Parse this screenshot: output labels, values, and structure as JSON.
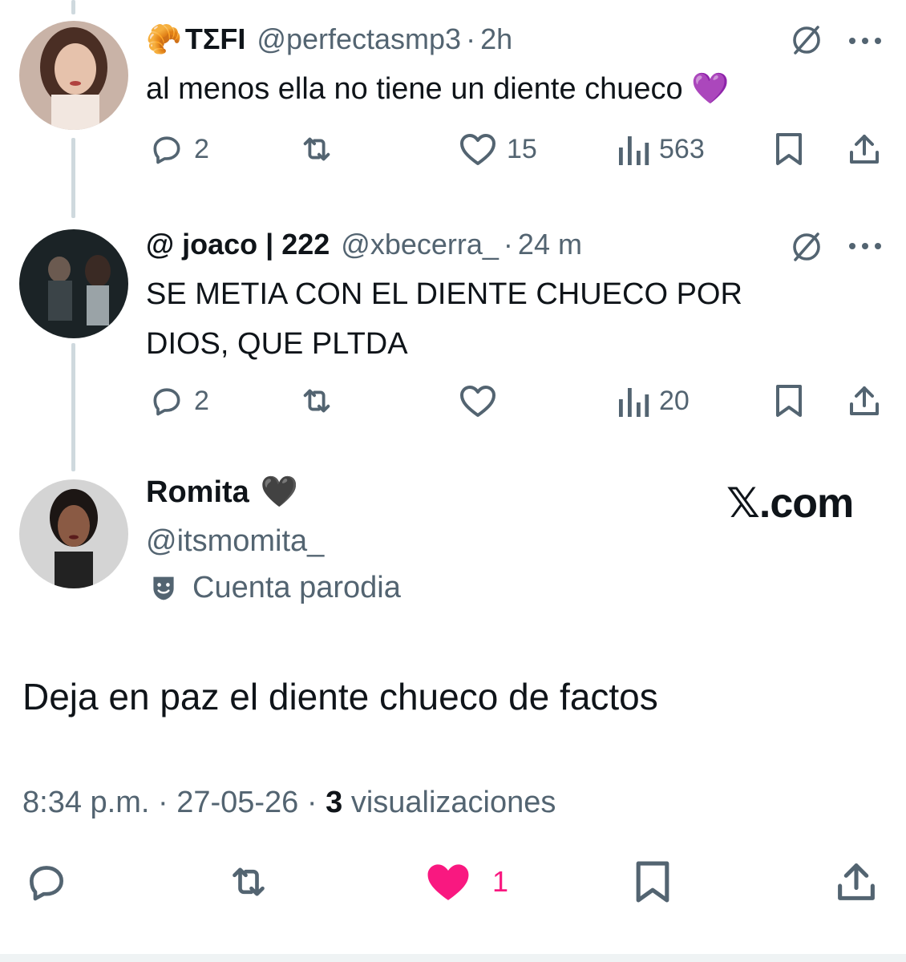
{
  "tweets": [
    {
      "emoji": "🥐",
      "display_name": "ΤΣFI",
      "handle": "@perfectasmp3",
      "separator": "·",
      "time": "2h",
      "text_lines": [
        "al menos ella no tiene un diente chueco 💜"
      ],
      "replies": "2",
      "retweets": "",
      "likes": "15",
      "views": "563"
    },
    {
      "display_name": "@ joaco | 222",
      "handle": "@xbecerra_",
      "separator": "·",
      "time": "24 m",
      "text_lines": [
        "SE METIA CON EL DIENTE CHUECO POR",
        "DIOS, QUE PLTDA"
      ],
      "replies": "2",
      "retweets": "",
      "likes": "",
      "views": "20"
    }
  ],
  "main_tweet": {
    "display_name": "Romita",
    "name_emoji": "🖤",
    "handle": "@itsmomita_",
    "parody_label": "Cuenta parodia",
    "text": "Deja en paz el diente chueco de factos",
    "time": "8:34 p.m.",
    "date": "27-05-26",
    "views_count": "3",
    "views_label": "visualizaciones",
    "likes": "1",
    "liked": true
  },
  "watermark": "𝕏.com",
  "icons": {
    "reply": "reply-icon",
    "retweet": "retweet-icon",
    "like": "heart-icon",
    "views": "views-icon",
    "bookmark": "bookmark-icon",
    "share": "share-icon",
    "grok": "grok-icon",
    "more": "more-icon",
    "parody": "theater-mask-icon"
  },
  "colors": {
    "text_primary": "#0f1419",
    "text_secondary": "#536471",
    "like_active": "#f91880",
    "thread_line": "#cfd9de"
  }
}
